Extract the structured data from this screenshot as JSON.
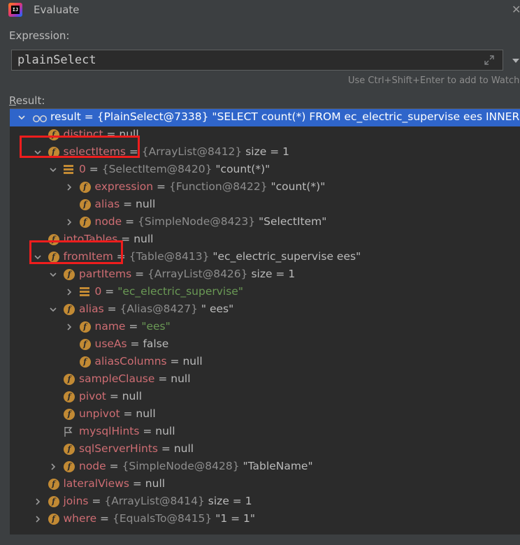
{
  "window": {
    "title": "Evaluate",
    "icons": {
      "app": "intellij-idea-icon",
      "close": "close-icon"
    }
  },
  "expression": {
    "label": "Expression:",
    "value": "plainSelect",
    "hint": "Use Ctrl+Shift+Enter to add to Watches"
  },
  "result": {
    "label_prefix": "R",
    "label_rest": "esult:",
    "rows": [
      {
        "expanded": true,
        "icon": "watch",
        "name": "result",
        "ref": "{PlainSelect@7338}",
        "value": "\"SELECT count(*) FROM ec_electric_supervise ees INNER JOIN",
        "selected": true
      },
      {
        "icon": "field",
        "name": "distinct",
        "value": "null"
      },
      {
        "expanded": true,
        "icon": "field",
        "name": "selectItems",
        "ref": "{ArrayList@8412}",
        "value": " size = 1"
      },
      {
        "expanded": true,
        "icon": "array",
        "name": "0",
        "ref": "{SelectItem@8420}",
        "value": "\"count(*)\""
      },
      {
        "expanded": false,
        "icon": "field",
        "name": "expression",
        "ref": "{Function@8422}",
        "value": "\"count(*)\""
      },
      {
        "icon": "field",
        "name": "alias",
        "value": "null"
      },
      {
        "expanded": false,
        "icon": "field",
        "name": "node",
        "ref": "{SimpleNode@8423}",
        "value": "\"SelectItem\""
      },
      {
        "icon": "field",
        "name": "intoTables",
        "value": "null"
      },
      {
        "expanded": true,
        "icon": "field",
        "name": "fromItem",
        "ref": "{Table@8413}",
        "value": "\"ec_electric_supervise ees\""
      },
      {
        "expanded": true,
        "icon": "field",
        "name": "partItems",
        "ref": "{ArrayList@8426}",
        "value": " size = 1"
      },
      {
        "expanded": false,
        "icon": "array",
        "name": "0",
        "str": "\"ec_electric_supervise\""
      },
      {
        "expanded": true,
        "icon": "field",
        "name": "alias",
        "ref": "{Alias@8427}",
        "value": "\" ees\""
      },
      {
        "expanded": false,
        "icon": "field",
        "name": "name",
        "str": "\"ees\""
      },
      {
        "icon": "field",
        "name": "useAs",
        "value": "false"
      },
      {
        "icon": "field",
        "name": "aliasColumns",
        "value": "null"
      },
      {
        "icon": "field",
        "name": "sampleClause",
        "value": "null"
      },
      {
        "icon": "field",
        "name": "pivot",
        "value": "null"
      },
      {
        "icon": "field",
        "name": "unpivot",
        "value": "null"
      },
      {
        "icon": "flag",
        "name": "mysqlHints",
        "value": "null"
      },
      {
        "icon": "field",
        "name": "sqlServerHints",
        "value": "null"
      },
      {
        "expanded": false,
        "icon": "field",
        "name": "node",
        "ref": "{SimpleNode@8428}",
        "value": "\"TableName\""
      },
      {
        "icon": "field",
        "name": "lateralViews",
        "value": "null"
      },
      {
        "expanded": false,
        "icon": "field",
        "name": "joins",
        "ref": "{ArrayList@8414}",
        "value": " size = 1"
      },
      {
        "expanded": false,
        "icon": "field",
        "name": "where",
        "ref": "{EqualsTo@8415}",
        "value": "\"1 = 1\""
      }
    ]
  },
  "colors": {
    "accent": "#2f65ca",
    "field_icon": "#c28a34",
    "field_name": "#ce6d73",
    "string": "#6a9955",
    "highlight": "#ee1d1d"
  }
}
